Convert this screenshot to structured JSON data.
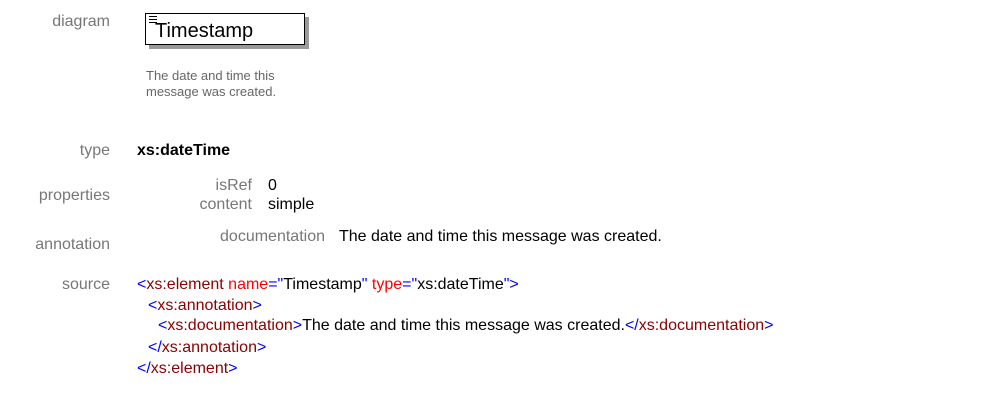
{
  "labels": {
    "diagram": "diagram",
    "type": "type",
    "properties": "properties",
    "annotation": "annotation",
    "source": "source"
  },
  "diagram": {
    "element_name": "Timestamp",
    "doc_line1": "The date and time this",
    "doc_line2": "message was created."
  },
  "type_value": "xs:dateTime",
  "properties": {
    "isRef_key": "isRef",
    "isRef_val": "0",
    "content_key": "content",
    "content_val": "simple"
  },
  "annotation": {
    "key": "documentation",
    "val": "The date and time this message was created."
  },
  "source": {
    "line1_tag": "xs:element",
    "line1_attr1": "name",
    "line1_val1": "Timestamp",
    "line1_attr2": "type",
    "line1_val2": "xs:dateTime",
    "line2_tag": "xs:annotation",
    "line3_tag_open": "xs:documentation",
    "line3_text": "The date and time this message was created.",
    "line3_tag_close": "xs:documentation",
    "line4_tag": "xs:annotation",
    "line5_tag": "xs:element"
  },
  "colors": {
    "tag": "#8b0000",
    "attr": "#ff0000",
    "punct": "#0000ff",
    "label": "#777777"
  }
}
